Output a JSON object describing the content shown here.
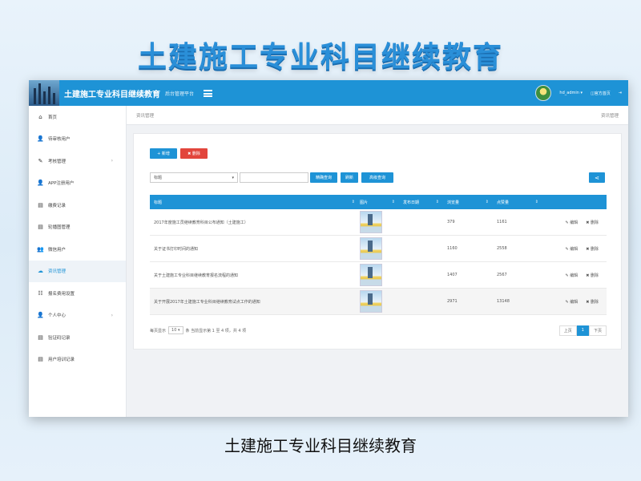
{
  "page": {
    "headline": "土建施工专业科目继续教育",
    "caption": "土建施工专业科目继续教育"
  },
  "header": {
    "title": "土建施工专业科目继续教育",
    "subtitle": "后台管理平台",
    "username": "hd_admin",
    "user_caret": "▾",
    "link1": "官方首页",
    "link1_icon": "◫",
    "logout_icon": "⇥",
    "logout_label": "退出"
  },
  "sidebar": {
    "items": [
      {
        "icon": "⌂",
        "label": "首页",
        "arrow": ""
      },
      {
        "icon": "👤",
        "label": "待审核用户",
        "arrow": ""
      },
      {
        "icon": "✎",
        "label": "考核管理",
        "arrow": "›"
      },
      {
        "icon": "👤",
        "label": "APP注册用户",
        "arrow": ""
      },
      {
        "icon": "▤",
        "label": "缴费记录",
        "arrow": ""
      },
      {
        "icon": "▤",
        "label": "轮播图管理",
        "arrow": ""
      },
      {
        "icon": "👥",
        "label": "微信用户",
        "arrow": ""
      },
      {
        "icon": "☁",
        "label": "资讯管理",
        "arrow": ""
      },
      {
        "icon": "☷",
        "label": "报名费用设置",
        "arrow": ""
      },
      {
        "icon": "👤",
        "label": "个人中心",
        "arrow": "›"
      },
      {
        "icon": "▤",
        "label": "验证码记录",
        "arrow": ""
      },
      {
        "icon": "▤",
        "label": "用户培训记录",
        "arrow": ""
      }
    ]
  },
  "breadcrumb": {
    "left": "资讯管理",
    "right": "资讯管理"
  },
  "toolbar": {
    "add": "+ 新增",
    "delete": "✖ 删除",
    "select_value": "标题",
    "select_caret": "▾",
    "search_placeholder": "",
    "query": "精确查询",
    "reset": "刷新",
    "advanced": "高级查询",
    "share_icon": "⋖"
  },
  "table": {
    "columns": {
      "title": "标题",
      "image": "图片",
      "status": "发布日期",
      "reads": "浏览量",
      "likes": "点赞量",
      "sort_icon": "⇕"
    },
    "rows": [
      {
        "title": "2017年度施工员继续教育科目公布通知（土建施工）",
        "reads": "379",
        "likes": "1161",
        "edit": "✎ 编辑",
        "delete": "✖ 删除"
      },
      {
        "title": "关于证书打印时间的通知",
        "reads": "1160",
        "likes": "2558",
        "edit": "✎ 编辑",
        "delete": "✖ 删除"
      },
      {
        "title": "关于土建施工专业科目继续教育报名流程的通知",
        "reads": "1407",
        "likes": "2567",
        "edit": "✎ 编辑",
        "delete": "✖ 删除"
      },
      {
        "title": "关于开展2017年土建施工专业科目继续教育试点工作的通知",
        "reads": "2971",
        "likes": "13148",
        "edit": "✎ 编辑",
        "delete": "✖ 删除"
      }
    ]
  },
  "footer": {
    "prefix": "每页显示",
    "page_size": "10",
    "page_size_caret": "▾",
    "suffix": "条  当前显示第 1 至 4 项，共 4 项",
    "prev": "上页",
    "current": "1",
    "next": "下页"
  },
  "colors": {
    "primary": "#1e93d6",
    "danger": "#e2453c"
  }
}
